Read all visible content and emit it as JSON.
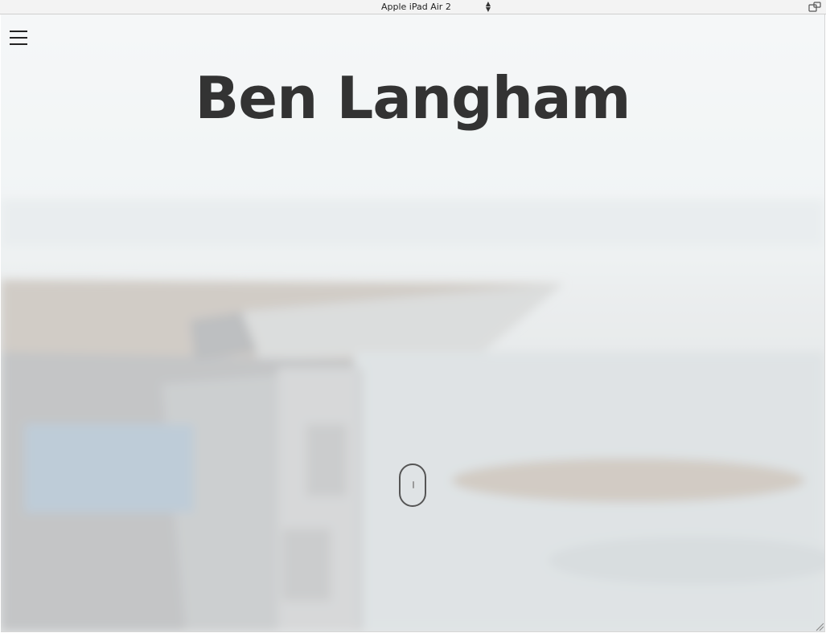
{
  "device_toolbar": {
    "device_name": "Apple iPad Air 2",
    "rotate_icon": "rotate-device-icon"
  },
  "site": {
    "title": "Ben Langham",
    "menu_icon": "hamburger-menu-icon",
    "scroll_icon": "scroll-down-mouse-icon"
  },
  "colors": {
    "title": "#333333",
    "toolbar_bg": "#f3f3f3",
    "hero_sky": "#eef1f2",
    "hero_overlay": "rgba(255,255,255,0.78)"
  }
}
